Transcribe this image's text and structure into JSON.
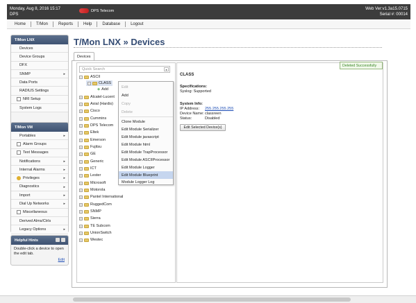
{
  "topbar": {
    "date_line1": "Monday, Aug 8, 2016 15:17",
    "date_line2": "DPS",
    "brand": "DPS Telecom",
    "version": "Web Ver:v1.3a15.0715",
    "serial": "Serial #: 00014"
  },
  "menu": [
    "Home",
    "T/Mon",
    "Reports",
    "Help",
    "Database",
    "Logout"
  ],
  "sidebar_tmon": {
    "title": "T/Mon LNX",
    "items": [
      {
        "label": "Devices"
      },
      {
        "label": "Device Groups"
      },
      {
        "label": "DFX"
      },
      {
        "label": "SNMP",
        "arrow": "▸"
      },
      {
        "label": "Data Ports"
      },
      {
        "label": "RADIUS Settings"
      },
      {
        "label": "NRI Setup"
      },
      {
        "label": "System Logs"
      }
    ]
  },
  "sidebar_vm": {
    "title": "T/Mon VM",
    "items": [
      {
        "label": "Portables",
        "arrow": "▸"
      },
      {
        "label": "Alarm Groups"
      },
      {
        "label": "Text Messages"
      },
      {
        "label": "Notifications",
        "arrow": "▸"
      },
      {
        "label": "Internal Alarms",
        "arrow": "▸"
      },
      {
        "label": "Privileges",
        "arrow": "▸"
      },
      {
        "label": "Diagnostics",
        "arrow": "▸"
      },
      {
        "label": "Import",
        "arrow": "▸"
      },
      {
        "label": "Dial Up Networks",
        "arrow": "▸"
      },
      {
        "label": "Miscellaneous"
      },
      {
        "label": "Derived Alms/Ctrls"
      },
      {
        "label": "Legacy Options",
        "arrow": "▸"
      }
    ]
  },
  "help": {
    "title": "Helpful Hints",
    "text": "Double-click a device to open the edit tab.",
    "edit": "Edit"
  },
  "page": {
    "title": "T/Mon LNX » Devices",
    "tab": "Devices",
    "search_placeholder": "Quick Search"
  },
  "tree": [
    {
      "label": "ASCII"
    },
    {
      "label": "CLASS"
    },
    {
      "label": "Add"
    },
    {
      "label": "Alcatel-Lucent"
    },
    {
      "label": "Axial (Hardis)"
    },
    {
      "label": "Cisco"
    },
    {
      "label": "Cummins"
    },
    {
      "label": "DPS Telecom"
    },
    {
      "label": "Eltek"
    },
    {
      "label": "Emerson"
    },
    {
      "label": "Fujitsu"
    },
    {
      "label": "GE"
    },
    {
      "label": "Generic"
    },
    {
      "label": "ICT"
    },
    {
      "label": "Lester"
    },
    {
      "label": "Microsoft"
    },
    {
      "label": "Motorola"
    },
    {
      "label": "Pantel International"
    },
    {
      "label": "RuggedCom"
    },
    {
      "label": "SNMP"
    },
    {
      "label": "Sierra"
    },
    {
      "label": "TE Subcom"
    },
    {
      "label": "UnionSwitch"
    },
    {
      "label": "Westec"
    }
  ],
  "context_menu": [
    {
      "label": "Edit",
      "state": "disabled"
    },
    {
      "label": "Add",
      "state": "normal"
    },
    {
      "label": "Copy",
      "state": "disabled"
    },
    {
      "label": "Delete",
      "state": "disabled"
    },
    {
      "label": "Clone Module",
      "state": "normal"
    },
    {
      "label": "Edit Module Serializer",
      "state": "normal"
    },
    {
      "label": "Edit Module javascript",
      "state": "normal"
    },
    {
      "label": "Edit Module html",
      "state": "normal"
    },
    {
      "label": "Edit Module TrapProcessor",
      "state": "normal"
    },
    {
      "label": "Edit Module ASCIIProcessor",
      "state": "normal"
    },
    {
      "label": "Edit Module Logger",
      "state": "normal"
    },
    {
      "label": "Edit Module Blueprint",
      "state": "highlighted"
    },
    {
      "label": "Module Logger Log",
      "state": "normal"
    }
  ],
  "detail": {
    "status_message": "Deleted Successfully",
    "title": "CLASS",
    "spec_heading": "Specifications:",
    "spec_value": "Syslog: Supported",
    "sys_heading": "System Info:",
    "ip_label": "IP Address:",
    "ip_value": "255.255.255.255",
    "name_label": "Device Name:",
    "name_value": "classreen",
    "status_label": "Status:",
    "status_value": "Disabled",
    "button_label": "Edit Selected Device(s)"
  },
  "colors": {
    "topbar": "#3c3c3c",
    "panel_header": "#3f5372",
    "title": "#344c74",
    "highlight": "#c6d6ef",
    "success": "#3c8a2a",
    "link": "#1a4bb5"
  }
}
